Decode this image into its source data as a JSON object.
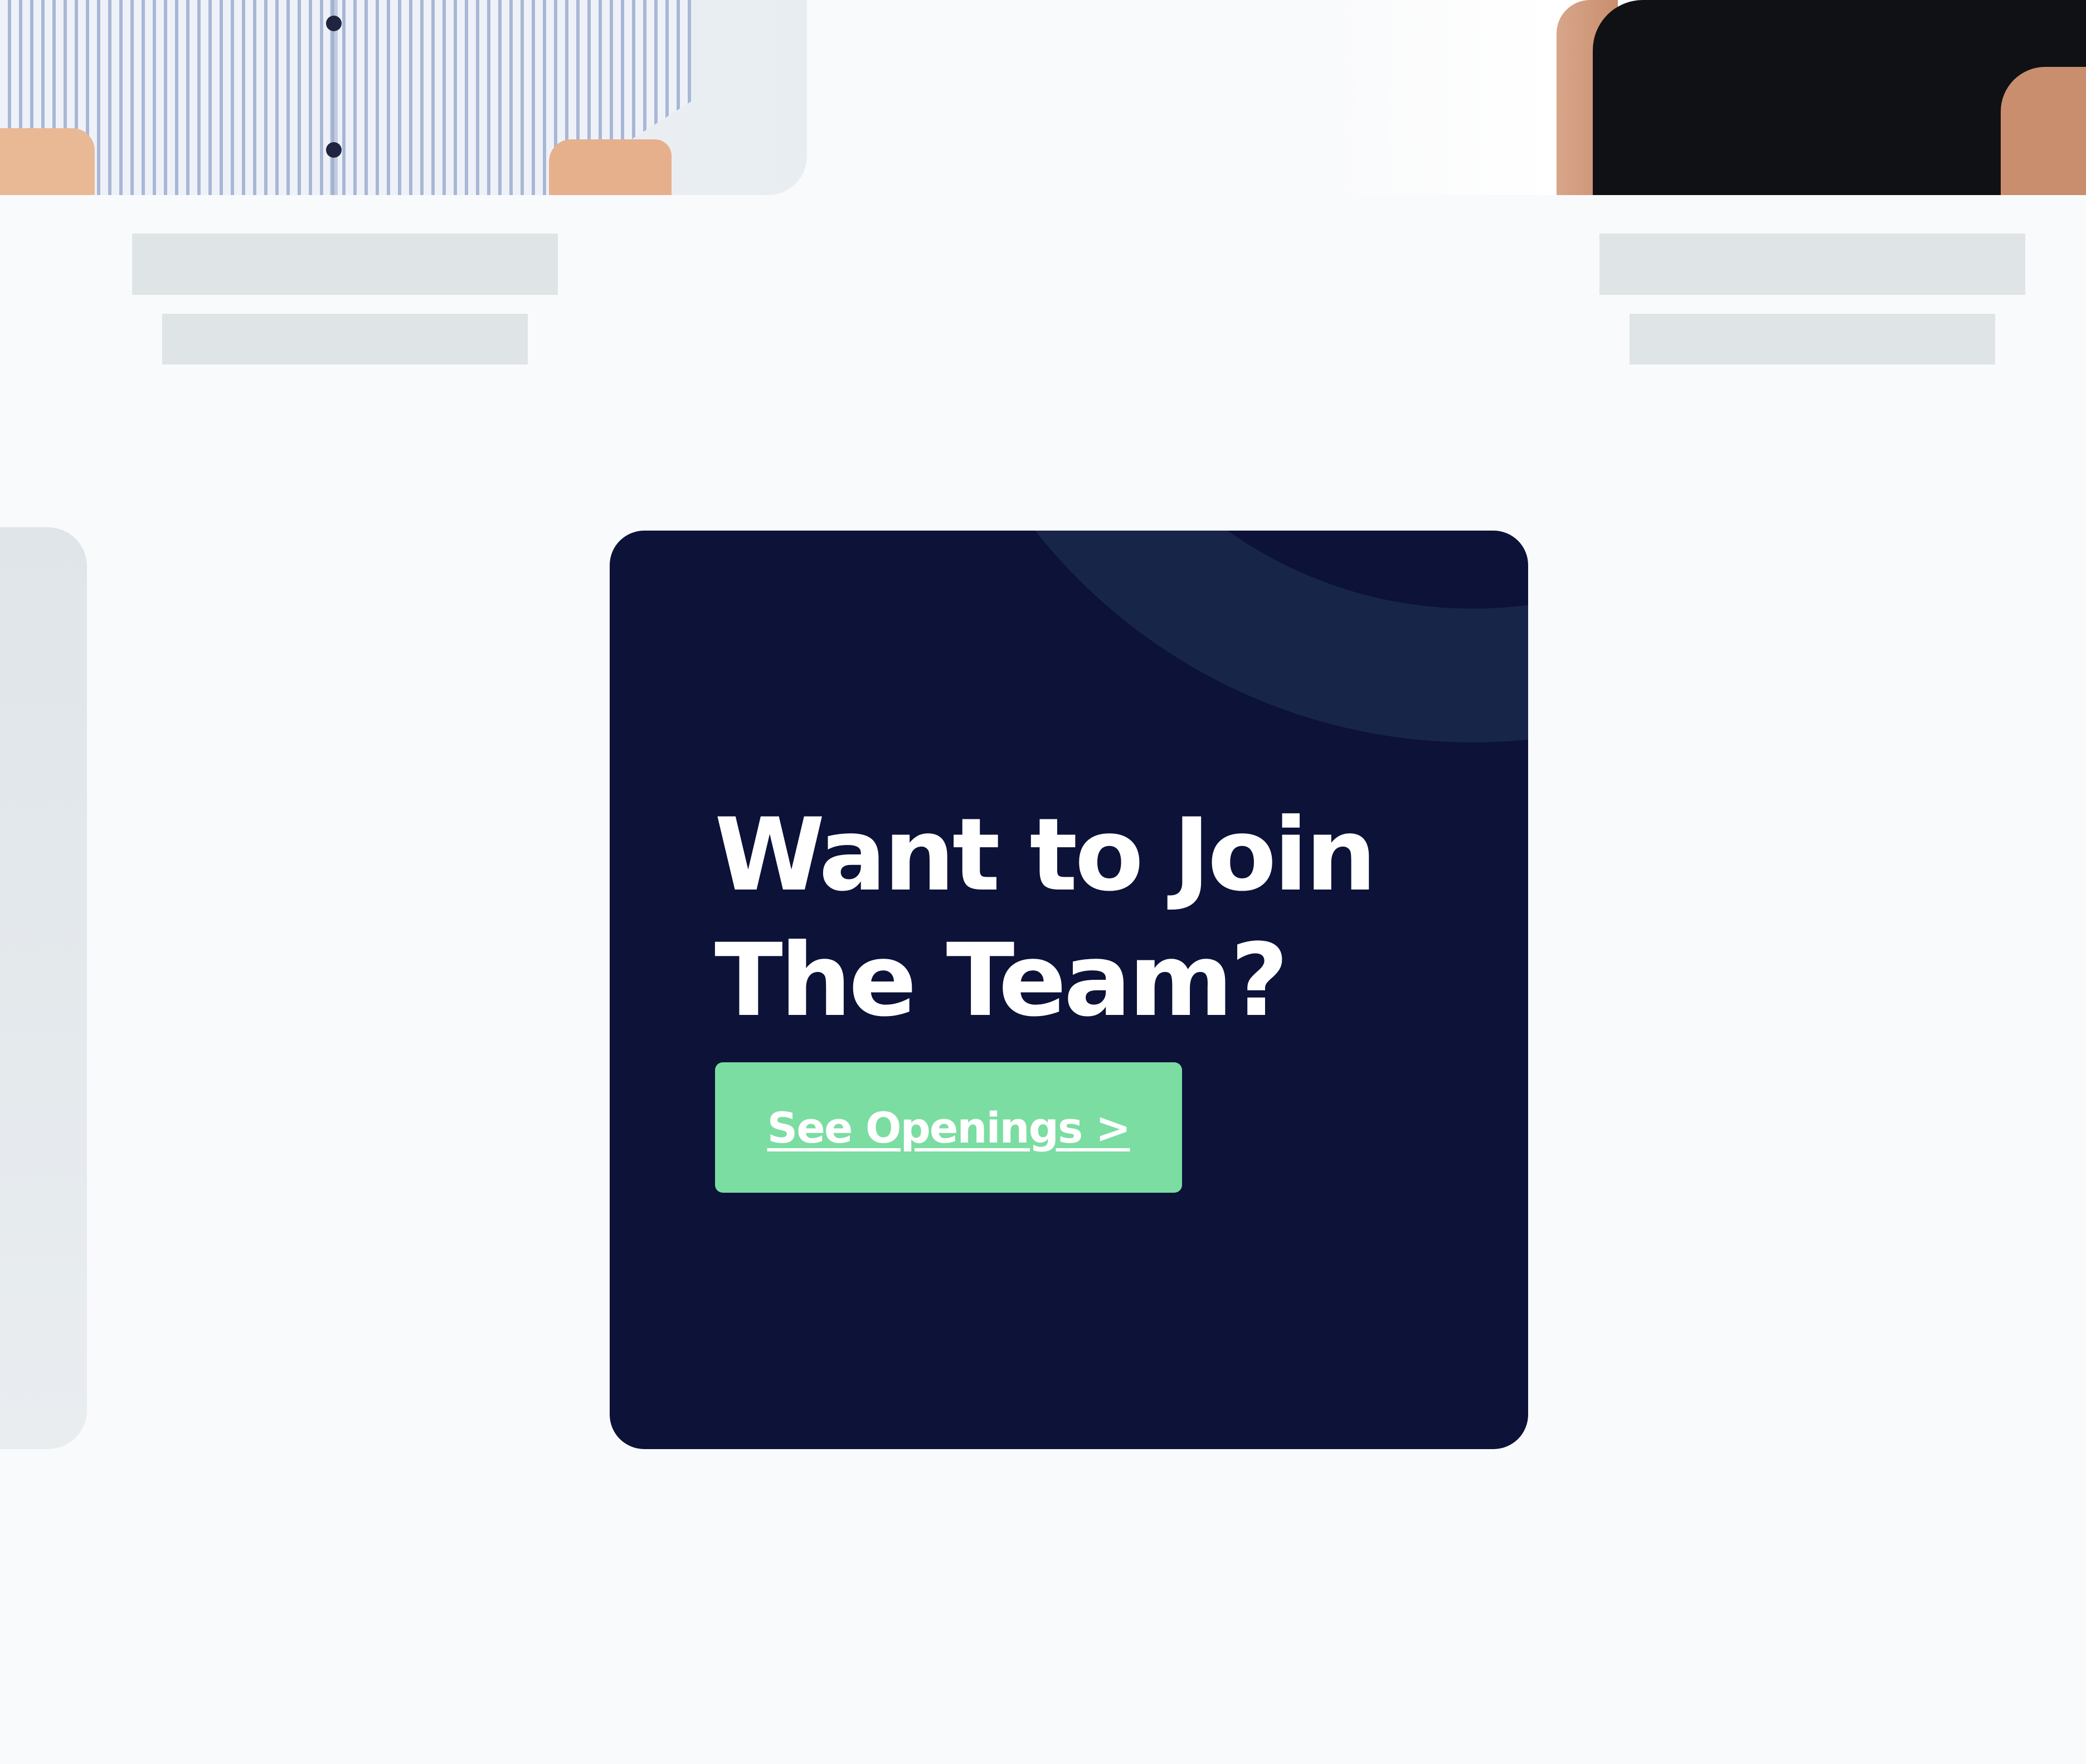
{
  "team_members": [
    {
      "photo": "team-member-photo-left"
    },
    {
      "photo": "team-member-photo-right"
    }
  ],
  "cta_card": {
    "title": "Want to Join\nThe Team?",
    "button_label": "See Openings >"
  },
  "colors": {
    "page_background": "#f9fafb",
    "card_background": "#0c1238",
    "card_arc": "#172648",
    "button_background": "#7bdda1",
    "placeholder": "#dfe4e7"
  }
}
